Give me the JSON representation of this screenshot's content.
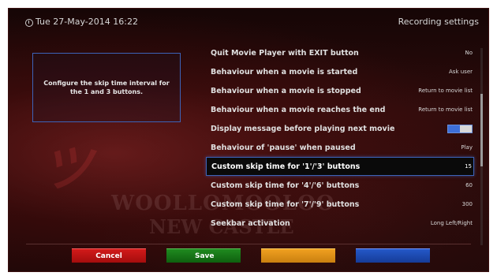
{
  "header": {
    "datetime": "Tue 27-May-2014 16:22",
    "title": "Recording settings"
  },
  "background": {
    "watermark_line1": "WOOLLOMOOLOO",
    "watermark_line2": "NEW CASTLE"
  },
  "help": {
    "text": "Configure the skip time interval for the 1 and 3 buttons."
  },
  "settings": [
    {
      "label": "Quit Movie Player with EXIT button",
      "value": "No"
    },
    {
      "label": "Behaviour when a movie is started",
      "value": "Ask user"
    },
    {
      "label": "Behaviour when a movie is stopped",
      "value": "Return to movie list"
    },
    {
      "label": "Behaviour when a movie reaches the end",
      "value": "Return to movie list"
    },
    {
      "label": "Display message before playing next movie",
      "value": "",
      "toggle_on": true
    },
    {
      "label": "Behaviour of 'pause' when paused",
      "value": "Play"
    },
    {
      "label": "Custom skip time for '1'/'3' buttons",
      "value": "15"
    },
    {
      "label": "Custom skip time for '4'/'6' buttons",
      "value": "60"
    },
    {
      "label": "Custom skip time for '7'/'9' buttons",
      "value": "300"
    },
    {
      "label": "Seekbar activation",
      "value": "Long Left/Right"
    }
  ],
  "selected_index": 6,
  "buttons": {
    "red": "Cancel",
    "green": "Save",
    "yellow": "",
    "blue": ""
  },
  "colors": {
    "accent": "#3d63b8",
    "red": "#c11515",
    "green": "#177717",
    "yellow": "#e89418",
    "blue": "#1f4cb8"
  }
}
